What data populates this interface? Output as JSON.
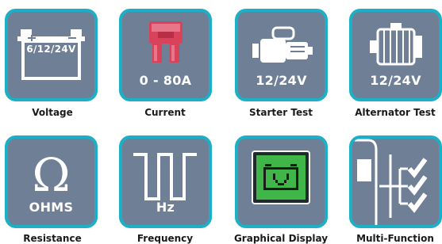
{
  "tiles": [
    {
      "name": "voltage",
      "icon": "battery-icon",
      "badge": "6/12/24V",
      "caption": "Voltage"
    },
    {
      "name": "current",
      "icon": "fuse-icon",
      "badge": "0 - 80A",
      "caption": "Current"
    },
    {
      "name": "starter-test",
      "icon": "starter-motor-icon",
      "badge": "12/24V",
      "caption": "Starter Test"
    },
    {
      "name": "alternator-test",
      "icon": "alternator-icon",
      "badge": "12/24V",
      "caption": "Alternator Test"
    },
    {
      "name": "resistance",
      "icon": "omega-icon",
      "badge": "OHMS",
      "caption": "Resistance"
    },
    {
      "name": "frequency",
      "icon": "square-wave-icon",
      "badge": "Hz",
      "caption": "Frequency"
    },
    {
      "name": "graphical-display",
      "icon": "pixel-display-icon",
      "badge": "",
      "caption": "Graphical Display"
    },
    {
      "name": "multi-function",
      "icon": "multimeter-checklist-icon",
      "badge": "",
      "caption": "Multi-Function"
    }
  ],
  "colors": {
    "tile_border": "#1bb0c8",
    "tile_fill": "#6f7f95",
    "icon_white": "#ffffff",
    "fuse_red": "#d8425a",
    "display_green": "#3fb54a"
  }
}
